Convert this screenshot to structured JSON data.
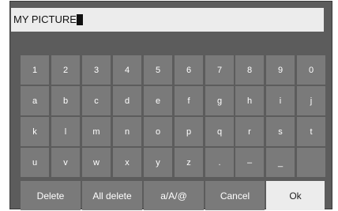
{
  "input": {
    "value": "MY PICTURE"
  },
  "rows": [
    [
      "1",
      "2",
      "3",
      "4",
      "5",
      "6",
      "7",
      "8",
      "9",
      "0"
    ],
    [
      "a",
      "b",
      "c",
      "d",
      "e",
      "f",
      "g",
      "h",
      "i",
      "j"
    ],
    [
      "k",
      "l",
      "m",
      "n",
      "o",
      "p",
      "q",
      "r",
      "s",
      "t"
    ],
    [
      "u",
      "v",
      "w",
      "x",
      "y",
      "z",
      ".",
      "–",
      "_",
      ""
    ]
  ],
  "functions": [
    {
      "label": "Delete",
      "active": false
    },
    {
      "label": "All delete",
      "active": false
    },
    {
      "label": "a/A/@",
      "active": false
    },
    {
      "label": "Cancel",
      "active": false
    },
    {
      "label": "Ok",
      "active": true
    }
  ]
}
